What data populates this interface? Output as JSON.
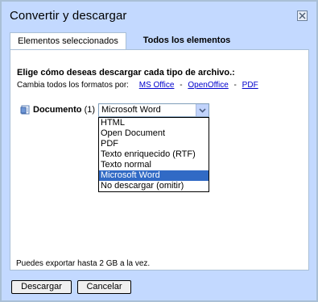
{
  "dialog": {
    "title": "Convertir y descargar"
  },
  "tabs": [
    {
      "label": "Elementos seleccionados",
      "active": true
    },
    {
      "label": "Todos los elementos",
      "active": false
    }
  ],
  "content": {
    "heading": "Elige cómo deseas descargar cada tipo de archivo.:",
    "change_all_label": "Cambia todos los formatos por:",
    "format_links": [
      "MS Office",
      "OpenOffice",
      "PDF"
    ],
    "separator": "-",
    "document": {
      "label": "Documento",
      "count": "(1)",
      "selected": "Microsoft Word",
      "options": [
        "HTML",
        "Open Document",
        "PDF",
        "Texto enriquecido (RTF)",
        "Texto normal",
        "Microsoft Word",
        "No descargar (omitir)"
      ],
      "selected_index": 5
    },
    "note": "Puedes exportar hasta 2 GB a la vez."
  },
  "buttons": {
    "download": "Descargar",
    "cancel": "Cancelar"
  },
  "colors": {
    "frame": "#c3d9ff",
    "link": "#0000cc",
    "highlight": "#316ac5"
  }
}
